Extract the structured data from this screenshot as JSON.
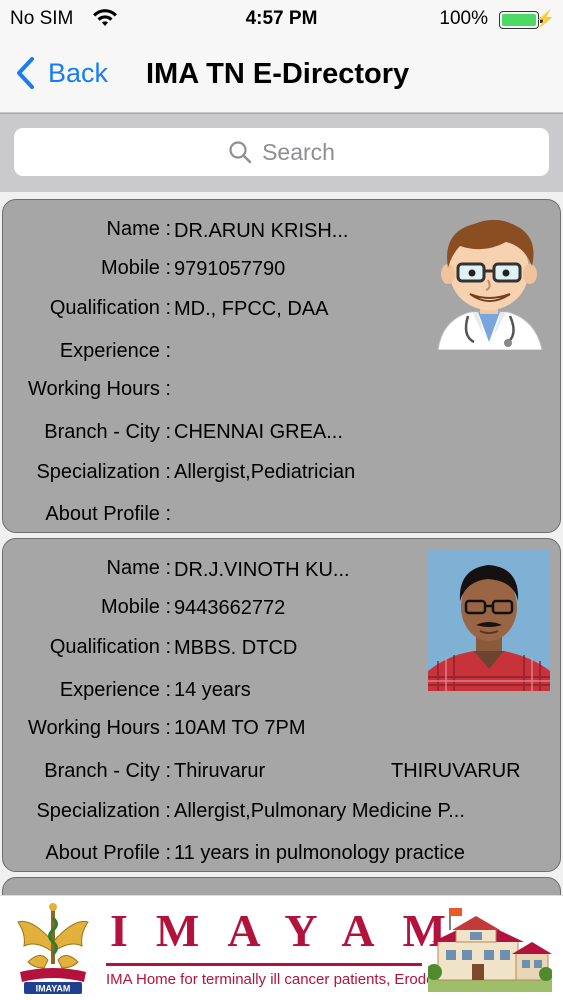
{
  "status_bar": {
    "carrier": "No SIM",
    "time": "4:57 PM",
    "battery": "100%",
    "wifi_icon": "wifi-icon",
    "battery_icon": "battery-icon",
    "charging_icon": "bolt-icon"
  },
  "nav": {
    "back_label": "Back",
    "title": "IMA TN E-Directory",
    "accent": "#1a7cf5"
  },
  "search": {
    "placeholder": "Search"
  },
  "labels": {
    "name": "Name :",
    "mobile": "Mobile :",
    "qualification": "Qualification :",
    "experience": "Experience :",
    "working_hours": "Working Hours :",
    "branch_city": "Branch - City :",
    "specialization": "Specialization :",
    "about": "About Profile :"
  },
  "doctors": [
    {
      "name": "DR.ARUN KRISH...",
      "mobile": "9791057790",
      "qualification": "MD., FPCC, DAA",
      "experience": "",
      "working_hours": "",
      "branch": "CHENNAI GREA...",
      "city": "",
      "specialization": "Allergist,Pediatrician",
      "about": "",
      "photo_icon": "cartoon-doctor-avatar"
    },
    {
      "name": "DR.J.VINOTH KU...",
      "mobile": "9443662772",
      "qualification": "MBBS. DTCD",
      "experience": "14 years",
      "working_hours": "10AM TO 7PM",
      "branch": "Thiruvarur",
      "city": "THIRUVARUR",
      "specialization": "Allergist,Pulmonary Medicine P...",
      "about": "11 years in pulmonology practice",
      "photo_icon": "doctor-photo"
    }
  ],
  "banner": {
    "brand": "IMAYAM",
    "tagline": "IMA Home for terminally ill cancer patients, Erode",
    "logo_text": "IMAYAM",
    "brand_color": "#b3123c"
  }
}
